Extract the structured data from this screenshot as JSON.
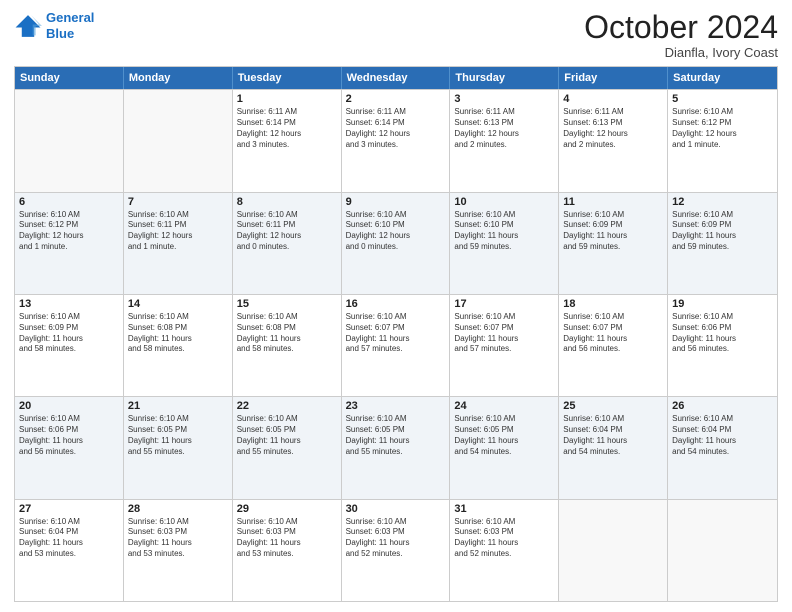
{
  "logo": {
    "line1": "General",
    "line2": "Blue"
  },
  "title": "October 2024",
  "subtitle": "Dianfla, Ivory Coast",
  "days": [
    "Sunday",
    "Monday",
    "Tuesday",
    "Wednesday",
    "Thursday",
    "Friday",
    "Saturday"
  ],
  "rows": [
    [
      {
        "day": "",
        "info": ""
      },
      {
        "day": "",
        "info": ""
      },
      {
        "day": "1",
        "info": "Sunrise: 6:11 AM\nSunset: 6:14 PM\nDaylight: 12 hours\nand 3 minutes."
      },
      {
        "day": "2",
        "info": "Sunrise: 6:11 AM\nSunset: 6:14 PM\nDaylight: 12 hours\nand 3 minutes."
      },
      {
        "day": "3",
        "info": "Sunrise: 6:11 AM\nSunset: 6:13 PM\nDaylight: 12 hours\nand 2 minutes."
      },
      {
        "day": "4",
        "info": "Sunrise: 6:11 AM\nSunset: 6:13 PM\nDaylight: 12 hours\nand 2 minutes."
      },
      {
        "day": "5",
        "info": "Sunrise: 6:10 AM\nSunset: 6:12 PM\nDaylight: 12 hours\nand 1 minute."
      }
    ],
    [
      {
        "day": "6",
        "info": "Sunrise: 6:10 AM\nSunset: 6:12 PM\nDaylight: 12 hours\nand 1 minute."
      },
      {
        "day": "7",
        "info": "Sunrise: 6:10 AM\nSunset: 6:11 PM\nDaylight: 12 hours\nand 1 minute."
      },
      {
        "day": "8",
        "info": "Sunrise: 6:10 AM\nSunset: 6:11 PM\nDaylight: 12 hours\nand 0 minutes."
      },
      {
        "day": "9",
        "info": "Sunrise: 6:10 AM\nSunset: 6:10 PM\nDaylight: 12 hours\nand 0 minutes."
      },
      {
        "day": "10",
        "info": "Sunrise: 6:10 AM\nSunset: 6:10 PM\nDaylight: 11 hours\nand 59 minutes."
      },
      {
        "day": "11",
        "info": "Sunrise: 6:10 AM\nSunset: 6:09 PM\nDaylight: 11 hours\nand 59 minutes."
      },
      {
        "day": "12",
        "info": "Sunrise: 6:10 AM\nSunset: 6:09 PM\nDaylight: 11 hours\nand 59 minutes."
      }
    ],
    [
      {
        "day": "13",
        "info": "Sunrise: 6:10 AM\nSunset: 6:09 PM\nDaylight: 11 hours\nand 58 minutes."
      },
      {
        "day": "14",
        "info": "Sunrise: 6:10 AM\nSunset: 6:08 PM\nDaylight: 11 hours\nand 58 minutes."
      },
      {
        "day": "15",
        "info": "Sunrise: 6:10 AM\nSunset: 6:08 PM\nDaylight: 11 hours\nand 58 minutes."
      },
      {
        "day": "16",
        "info": "Sunrise: 6:10 AM\nSunset: 6:07 PM\nDaylight: 11 hours\nand 57 minutes."
      },
      {
        "day": "17",
        "info": "Sunrise: 6:10 AM\nSunset: 6:07 PM\nDaylight: 11 hours\nand 57 minutes."
      },
      {
        "day": "18",
        "info": "Sunrise: 6:10 AM\nSunset: 6:07 PM\nDaylight: 11 hours\nand 56 minutes."
      },
      {
        "day": "19",
        "info": "Sunrise: 6:10 AM\nSunset: 6:06 PM\nDaylight: 11 hours\nand 56 minutes."
      }
    ],
    [
      {
        "day": "20",
        "info": "Sunrise: 6:10 AM\nSunset: 6:06 PM\nDaylight: 11 hours\nand 56 minutes."
      },
      {
        "day": "21",
        "info": "Sunrise: 6:10 AM\nSunset: 6:05 PM\nDaylight: 11 hours\nand 55 minutes."
      },
      {
        "day": "22",
        "info": "Sunrise: 6:10 AM\nSunset: 6:05 PM\nDaylight: 11 hours\nand 55 minutes."
      },
      {
        "day": "23",
        "info": "Sunrise: 6:10 AM\nSunset: 6:05 PM\nDaylight: 11 hours\nand 55 minutes."
      },
      {
        "day": "24",
        "info": "Sunrise: 6:10 AM\nSunset: 6:05 PM\nDaylight: 11 hours\nand 54 minutes."
      },
      {
        "day": "25",
        "info": "Sunrise: 6:10 AM\nSunset: 6:04 PM\nDaylight: 11 hours\nand 54 minutes."
      },
      {
        "day": "26",
        "info": "Sunrise: 6:10 AM\nSunset: 6:04 PM\nDaylight: 11 hours\nand 54 minutes."
      }
    ],
    [
      {
        "day": "27",
        "info": "Sunrise: 6:10 AM\nSunset: 6:04 PM\nDaylight: 11 hours\nand 53 minutes."
      },
      {
        "day": "28",
        "info": "Sunrise: 6:10 AM\nSunset: 6:03 PM\nDaylight: 11 hours\nand 53 minutes."
      },
      {
        "day": "29",
        "info": "Sunrise: 6:10 AM\nSunset: 6:03 PM\nDaylight: 11 hours\nand 53 minutes."
      },
      {
        "day": "30",
        "info": "Sunrise: 6:10 AM\nSunset: 6:03 PM\nDaylight: 11 hours\nand 52 minutes."
      },
      {
        "day": "31",
        "info": "Sunrise: 6:10 AM\nSunset: 6:03 PM\nDaylight: 11 hours\nand 52 minutes."
      },
      {
        "day": "",
        "info": ""
      },
      {
        "day": "",
        "info": ""
      }
    ]
  ]
}
